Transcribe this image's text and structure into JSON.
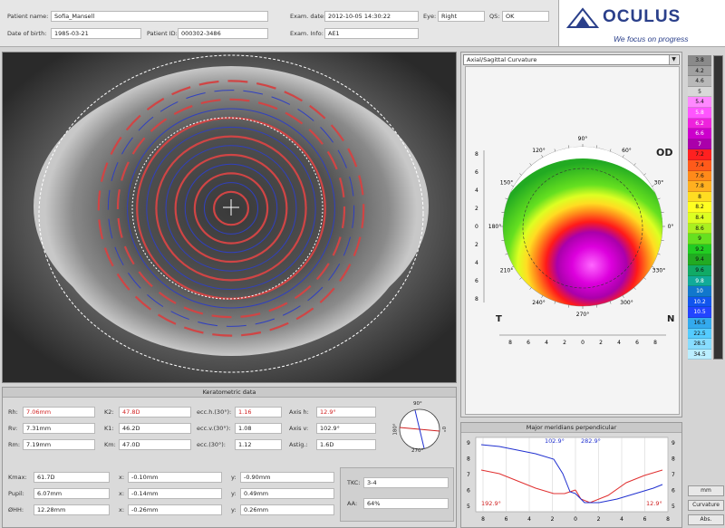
{
  "header": {
    "patient_name_label": "Patient name:",
    "patient_name_value": "Sofia_Mansell",
    "dob_label": "Date of birth:",
    "dob_value": "1985-03-21",
    "patient_id_label": "Patient ID:",
    "patient_id_value": "000302-3486",
    "exam_date_label": "Exam. date:",
    "exam_date_value": "2012-10-05 14:30:22",
    "eye_label": "Eye:",
    "eye_value": "Right",
    "qs_label": "QS:",
    "qs_value": "OK",
    "exam_info_label": "Exam. Info:",
    "exam_info_value": "AE1"
  },
  "logo": {
    "brand": "OCULUS",
    "slogan": "We focus on progress"
  },
  "map": {
    "type_select": "Axial/Sagittal Curvature",
    "eye_label": "OD",
    "temporal_label": "T",
    "nasal_label": "N",
    "angles": [
      "90°",
      "60°",
      "30°",
      "0°",
      "330°",
      "300°",
      "270°",
      "240°",
      "210°",
      "180°",
      "150°",
      "120°"
    ],
    "y_ticks": [
      "8",
      "6",
      "4",
      "2",
      "0",
      "2",
      "4",
      "6",
      "8"
    ],
    "x_ticks": [
      "8",
      "6",
      "4",
      "2",
      "0",
      "2",
      "4",
      "6",
      "8"
    ]
  },
  "scale": {
    "values": [
      "3.8",
      "4.2",
      "4.6",
      "5",
      "5.4",
      "5.8",
      "6.2",
      "6.6",
      "7",
      "7.2",
      "7.4",
      "7.6",
      "7.8",
      "8",
      "8.2",
      "8.4",
      "8.6",
      "9",
      "9.2",
      "9.4",
      "9.6",
      "9.8",
      "10",
      "10.2",
      "10.5",
      "16.5",
      "22.5",
      "28.5",
      "34.5"
    ],
    "colors": [
      "#8a8a8a",
      "#a0a0a0",
      "#b8b8b8",
      "#d8d8d8",
      "#ff88ff",
      "#ff55ff",
      "#ee22dd",
      "#cc00cc",
      "#aa00aa",
      "#ff2020",
      "#ff5a1a",
      "#ff8a1a",
      "#ffb020",
      "#ffdd22",
      "#ffff22",
      "#ddff22",
      "#aaf020",
      "#66e020",
      "#22cc22",
      "#22aa22",
      "#11aa66",
      "#11aa99",
      "#1177cc",
      "#1155ee",
      "#2244ff",
      "#33aaee",
      "#55ccff",
      "#88ddff",
      "#bbeeff"
    ],
    "mm_button": "mm",
    "curvature_button": "Curvature",
    "abs_button": "Abs."
  },
  "kera": {
    "title": "Keratometric data",
    "rh_label": "Rh:",
    "rh_value": "7.06mm",
    "rv_label": "Rv:",
    "rv_value": "7.31mm",
    "rm_label": "Rm:",
    "rm_value": "7.19mm",
    "k2_label": "K2:",
    "k2_value": "47.8D",
    "k1_label": "K1:",
    "k1_value": "46.2D",
    "km_label": "Km:",
    "km_value": "47.0D",
    "ecch_label": "ecc.h.(30°):",
    "ecch_value": "1.16",
    "eccv_label": "ecc.v.(30°):",
    "eccv_value": "1.08",
    "ecc_label": "ecc.(30°):",
    "ecc_value": "1.12",
    "axish_label": "Axis h:",
    "axish_value": "12.9°",
    "axisv_label": "Axis v:",
    "axisv_value": "102.9°",
    "astig_label": "Astig.:",
    "astig_value": "1.6D",
    "kmax_label": "Kmax:",
    "kmax_value": "61.7D",
    "pupil_label": "Pupil:",
    "pupil_value": "6.07mm",
    "hwtw_label": "ØHH:",
    "hwtw_value": "12.28mm",
    "x_label": "x:",
    "y_label": "y:",
    "kmax_x": "-0.10mm",
    "kmax_y": "-0.90mm",
    "pupil_x": "-0.14mm",
    "pupil_y": "0.49mm",
    "hwtw_x": "-0.26mm",
    "hwtw_y": "0.26mm",
    "tkc_label": "TKC:",
    "tkc_value": "3-4",
    "aa_label": "AA:",
    "aa_value": "64%",
    "dial_top": "90°",
    "dial_left": "180°",
    "dial_right": "0°",
    "dial_bottom": "270°"
  },
  "profile": {
    "title": "Major meridians perpendicular",
    "meridian_blue": "102.9°",
    "meridian_red_top": "282.9°",
    "meridian_red_left": "192.9°",
    "meridian_red_right": "12.9°",
    "y_ticks": [
      "9",
      "8",
      "7",
      "6",
      "5"
    ],
    "x_ticks": [
      "8",
      "6",
      "4",
      "2",
      "0",
      "2",
      "4",
      "6",
      "8"
    ]
  }
}
